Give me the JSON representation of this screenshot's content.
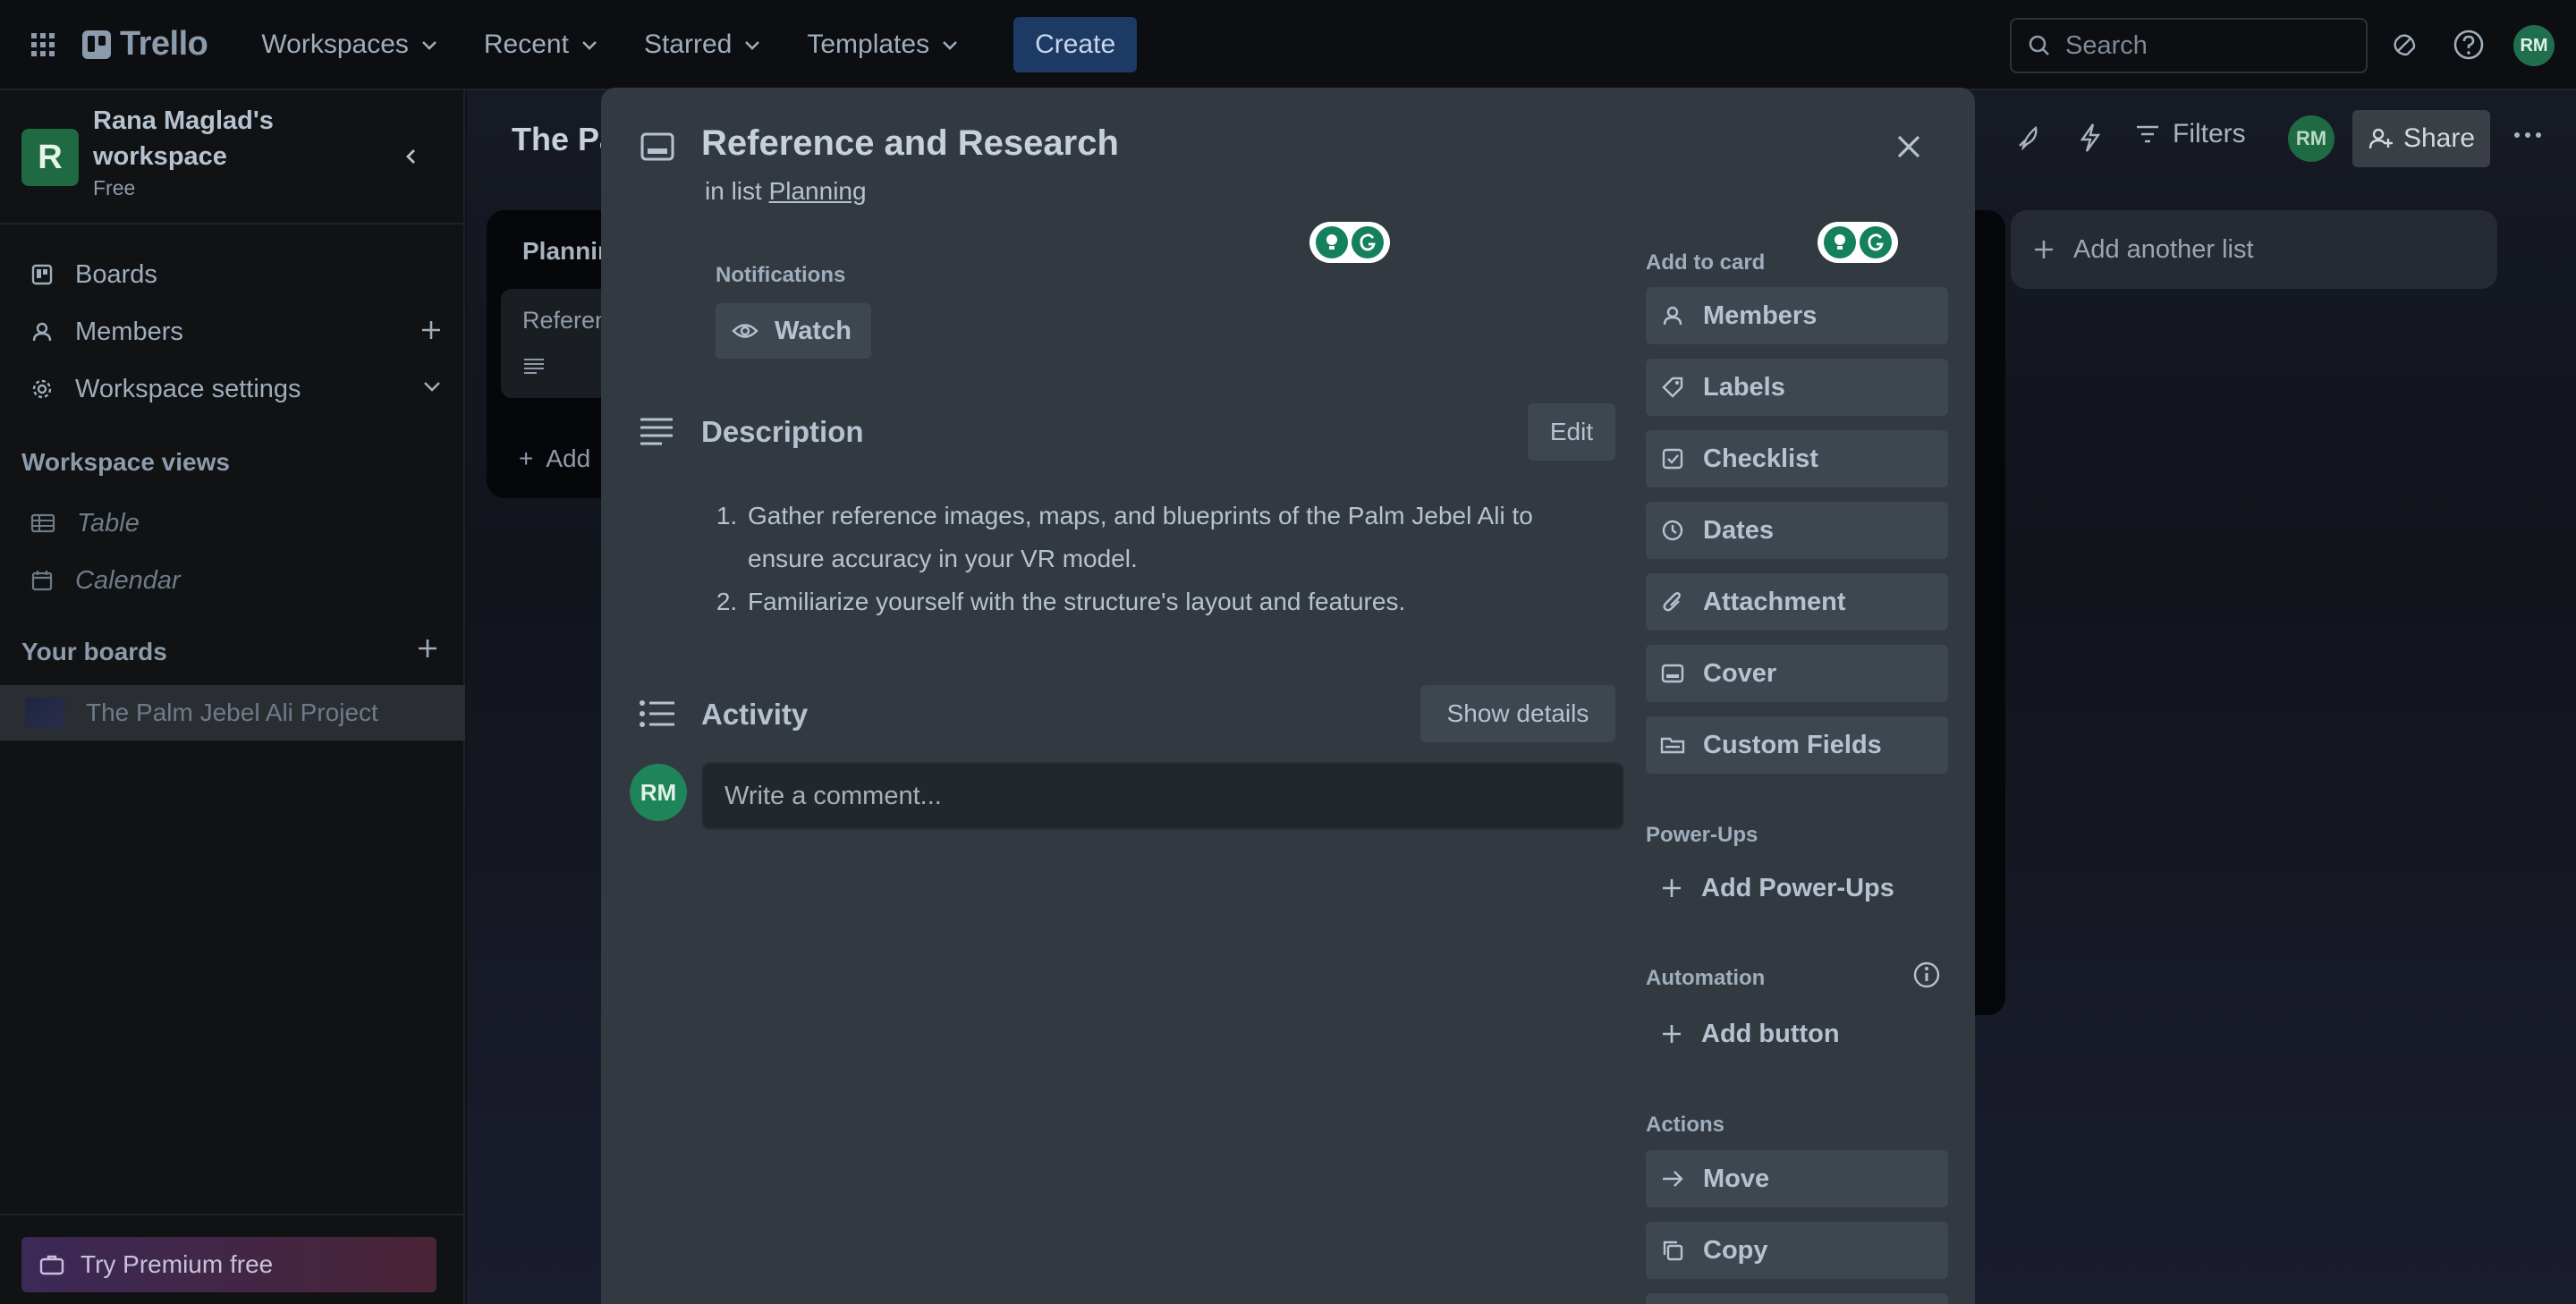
{
  "header": {
    "logo_text": "Trello",
    "nav": [
      {
        "label": "Workspaces"
      },
      {
        "label": "Recent"
      },
      {
        "label": "Starred"
      },
      {
        "label": "Templates"
      }
    ],
    "create_label": "Create",
    "search_placeholder": "Search",
    "avatar_initials": "RM"
  },
  "sidebar": {
    "workspace_initial": "R",
    "workspace_name": "Rana Maglad's workspace",
    "workspace_plan": "Free",
    "items": [
      {
        "label": "Boards"
      },
      {
        "label": "Members"
      },
      {
        "label": "Workspace settings"
      }
    ],
    "views_heading": "Workspace views",
    "views": [
      {
        "label": "Table"
      },
      {
        "label": "Calendar"
      }
    ],
    "boards_heading": "Your boards",
    "boards": [
      {
        "label": "The Palm Jebel Ali Project"
      }
    ],
    "premium_label": "Try Premium free"
  },
  "board": {
    "title": "The Pa",
    "list_title": "Plannin",
    "card_title": "Referen",
    "add_card": "Add",
    "add_list_label": "Add another list",
    "filters_label": "Filters",
    "avatar_initials": "RM",
    "share_label": "Share"
  },
  "modal": {
    "title": "Reference and Research",
    "in_list_prefix": "in list",
    "list_name": "Planning",
    "notifications_label": "Notifications",
    "watch_label": "Watch",
    "description_heading": "Description",
    "edit_label": "Edit",
    "description_items": [
      "Gather reference images, maps, and blueprints of the Palm Jebel Ali to ensure accuracy in your VR model.",
      "Familiarize yourself with the structure's layout and features."
    ],
    "activity_heading": "Activity",
    "show_details_label": "Show details",
    "comment_placeholder": "Write a comment...",
    "avatar_initials": "RM",
    "add_to_card_label": "Add to card",
    "add_to_card": [
      {
        "label": "Members",
        "icon": "person-icon"
      },
      {
        "label": "Labels",
        "icon": "tag-icon"
      },
      {
        "label": "Checklist",
        "icon": "checklist-icon"
      },
      {
        "label": "Dates",
        "icon": "clock-icon"
      },
      {
        "label": "Attachment",
        "icon": "paperclip-icon"
      },
      {
        "label": "Cover",
        "icon": "cover-icon"
      },
      {
        "label": "Custom Fields",
        "icon": "custom-fields-icon"
      }
    ],
    "power_ups_label": "Power-Ups",
    "add_power_ups_label": "Add Power-Ups",
    "automation_label": "Automation",
    "add_button_label": "Add button",
    "actions_label": "Actions",
    "actions": [
      {
        "label": "Move",
        "icon": "arrow-right-icon"
      },
      {
        "label": "Copy",
        "icon": "copy-icon"
      }
    ]
  },
  "colors": {
    "header_bg": "#0c0e11",
    "modal_bg": "#323940",
    "button_bg": "#3e474f",
    "create_bg": "#1c3a64",
    "avatar_green": "#1f845a"
  }
}
